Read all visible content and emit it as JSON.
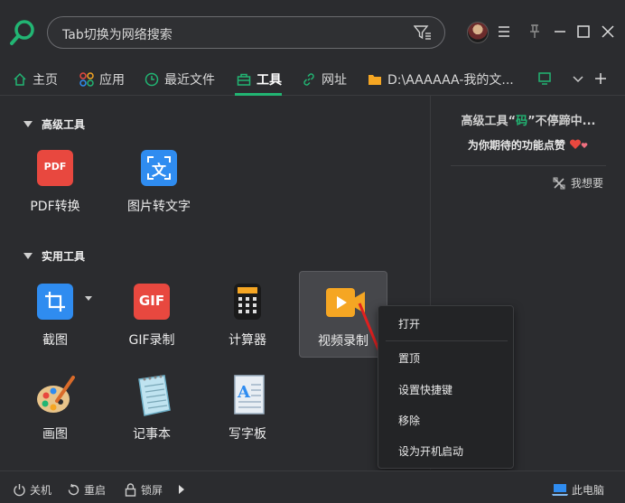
{
  "search": {
    "placeholder_text": "Tab切换为网络搜索"
  },
  "tabs": [
    {
      "label": "主页",
      "icon": "home-icon"
    },
    {
      "label": "应用",
      "icon": "apps-icon"
    },
    {
      "label": "最近文件",
      "icon": "clock-icon"
    },
    {
      "label": "工具",
      "icon": "toolbox-icon",
      "active": true
    },
    {
      "label": "网址",
      "icon": "link-icon"
    },
    {
      "label": "D:\\AAAAAA-我的文...",
      "icon": "folder-icon"
    }
  ],
  "sections": {
    "advanced": {
      "title": "高级工具",
      "tools": [
        {
          "label": "PDF转换"
        },
        {
          "label": "图片转文字"
        }
      ]
    },
    "practical": {
      "title": "实用工具",
      "tools": [
        {
          "label": "截图"
        },
        {
          "label": "GIF录制"
        },
        {
          "label": "计算器"
        },
        {
          "label": "视频录制"
        },
        {
          "label": "画图"
        },
        {
          "label": "记事本"
        },
        {
          "label": "写字板"
        }
      ]
    }
  },
  "icon_text": {
    "pdf": "PDF",
    "ocr": "文",
    "gif": "GIF"
  },
  "right_panel": {
    "title_prefix": "高级工具“",
    "title_highlight": "码",
    "title_suffix": "”不停蹄中...",
    "subtitle": "为你期待的功能点赞",
    "want_label": "我想要"
  },
  "context_menu": {
    "items": [
      "打开",
      "置顶",
      "设置快捷键",
      "移除",
      "设为开机启动"
    ]
  },
  "statusbar": {
    "shutdown": "关机",
    "restart": "重启",
    "lock": "锁屏",
    "this_pc": "此电脑"
  },
  "colors": {
    "accent": "#22b573",
    "pdf_red": "#e8483f",
    "ocr_blue": "#2f8cf0",
    "gif_red": "#e8483f",
    "video_orange": "#f5a623"
  }
}
